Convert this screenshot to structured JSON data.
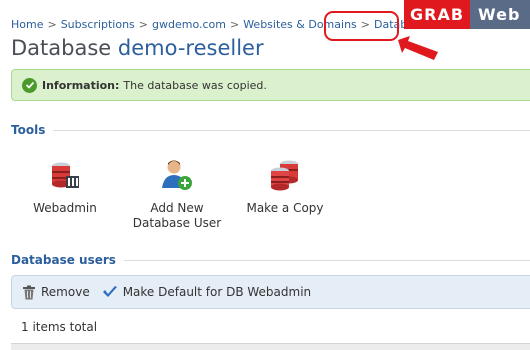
{
  "breadcrumb": {
    "items": [
      "Home",
      "Subscriptions",
      "gwdemo.com",
      "Websites & Domains",
      "Databases"
    ],
    "separator": ">"
  },
  "logo": {
    "part1": "GRAB",
    "part2": "Web"
  },
  "page": {
    "title_prefix": "Database",
    "title_name": "demo-reseller"
  },
  "info": {
    "label": "Information:",
    "message": "The database was copied."
  },
  "tools": {
    "heading": "Tools",
    "items": [
      {
        "label_line1": "Webadmin",
        "label_line2": ""
      },
      {
        "label_line1": "Add New",
        "label_line2": "Database User"
      },
      {
        "label_line1": "Make a Copy",
        "label_line2": ""
      }
    ]
  },
  "db_users": {
    "heading": "Database users",
    "remove_label": "Remove",
    "make_default_label": "Make Default for DB Webadmin",
    "items_total": "1 items total"
  },
  "colors": {
    "link": "#2b5f9e",
    "highlight": "#e0191e",
    "info_bg": "#dbf1cd",
    "toolbar_bg": "#e5eef7"
  }
}
